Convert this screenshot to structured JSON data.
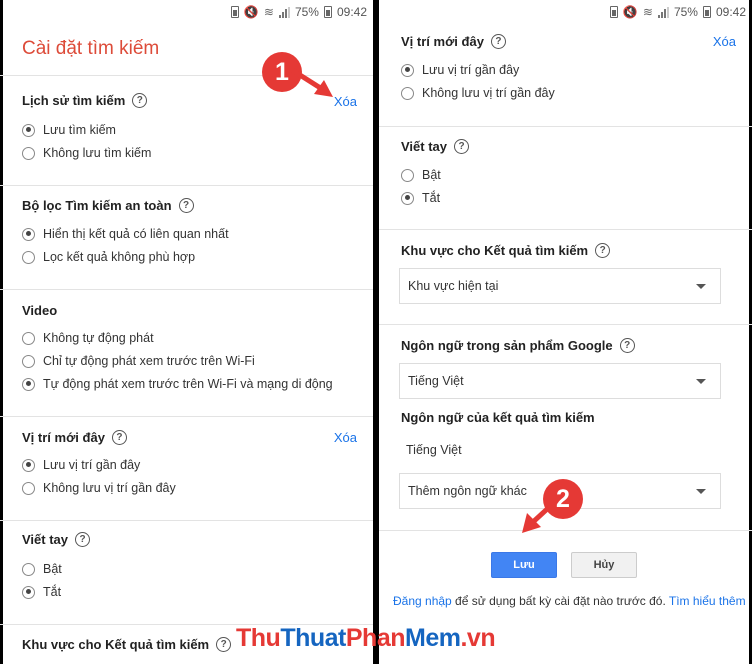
{
  "status": {
    "battery": "75%",
    "time": "09:42"
  },
  "left": {
    "title": "Cài đặt tìm kiếm",
    "history": {
      "heading": "Lịch sử tìm kiếm",
      "clear": "Xóa",
      "options": [
        "Lưu tìm kiếm",
        "Không lưu tìm kiếm"
      ]
    },
    "safesearch": {
      "heading": "Bộ lọc Tìm kiếm an toàn",
      "options": [
        "Hiển thị kết quả có liên quan nhất",
        "Lọc kết quả không phù hợp"
      ]
    },
    "video": {
      "heading": "Video",
      "options": [
        "Không tự động phát",
        "Chỉ tự động phát xem trước trên Wi-Fi",
        "Tự động phát xem trước trên Wi-Fi và mạng di động"
      ]
    },
    "location": {
      "heading": "Vị trí mới đây",
      "clear": "Xóa",
      "options": [
        "Lưu vị trí gần đây",
        "Không lưu vị trí gần đây"
      ]
    },
    "handwriting": {
      "heading": "Viết tay",
      "options": [
        "Bật",
        "Tắt"
      ]
    },
    "region": {
      "heading": "Khu vực cho Kết quả tìm kiếm"
    }
  },
  "right": {
    "location": {
      "heading": "Vị trí mới đây",
      "clear": "Xóa",
      "options": [
        "Lưu vị trí gần đây",
        "Không lưu vị trí gần đây"
      ]
    },
    "handwriting": {
      "heading": "Viết tay",
      "options": [
        "Bật",
        "Tắt"
      ]
    },
    "region": {
      "heading": "Khu vực cho Kết quả tìm kiếm",
      "value": "Khu vực hiện tại"
    },
    "product_lang": {
      "heading": "Ngôn ngữ trong sản phẩm Google",
      "value": "Tiếng Việt"
    },
    "result_lang": {
      "heading": "Ngôn ngữ của kết quả tìm kiếm",
      "current": "Tiếng Việt",
      "add": "Thêm ngôn ngữ khác"
    },
    "save": "Lưu",
    "cancel": "Hủy",
    "note": {
      "signin": "Đăng nhập",
      "middle": " để sử dụng bất kỳ cài đặt nào trước đó. ",
      "learn": "Tìm hiểu thêm"
    }
  },
  "annotations": {
    "one": "1",
    "two": "2"
  },
  "watermark": {
    "a": "Thu",
    "b": "Thuat",
    "c": "Phan",
    "d": "Mem",
    ".vn": ".vn",
    "e": ".vn"
  }
}
